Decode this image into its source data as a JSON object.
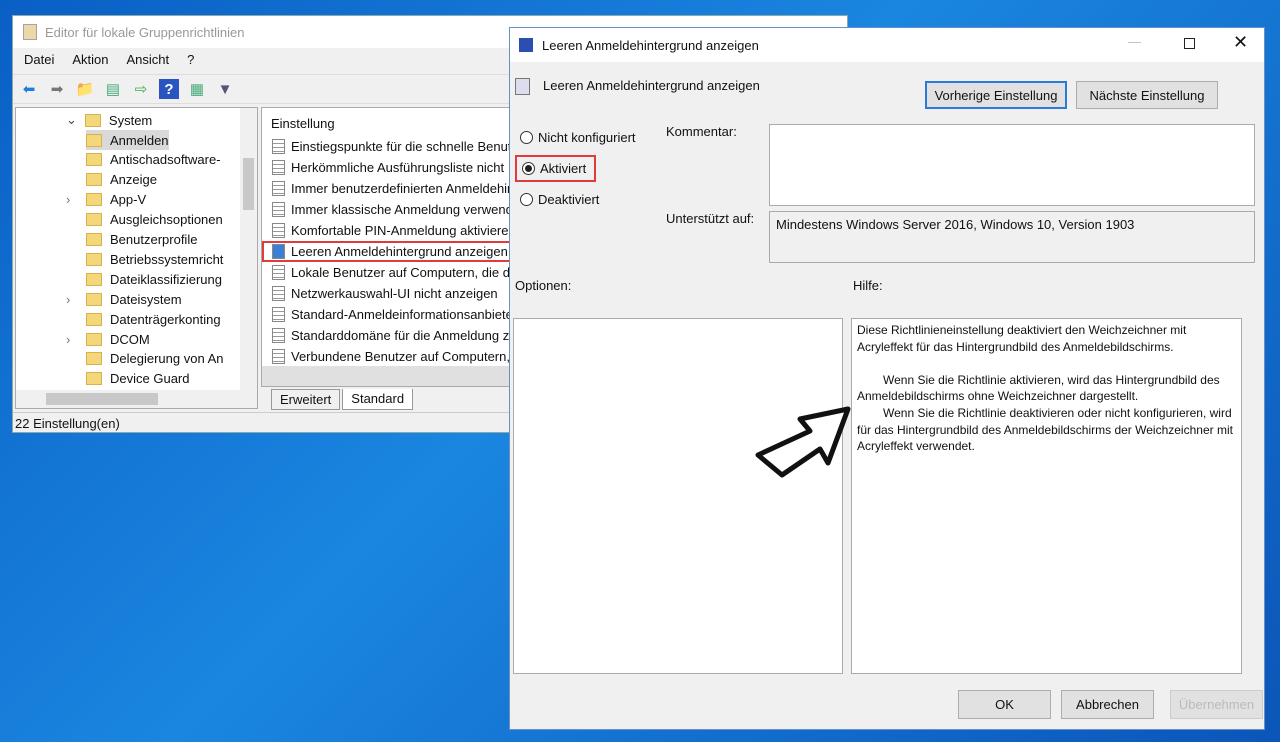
{
  "gpedit": {
    "title": "Editor für lokale Gruppenrichtlinien",
    "menu": [
      "Datei",
      "Aktion",
      "Ansicht",
      "?"
    ],
    "tree": [
      {
        "label": "System",
        "expanded": true
      },
      {
        "label": "Anmelden",
        "selected": true
      },
      {
        "label": "Antischadsoftware-"
      },
      {
        "label": "Anzeige"
      },
      {
        "label": "App-V",
        "expandable": true
      },
      {
        "label": "Ausgleichsoptionen"
      },
      {
        "label": "Benutzerprofile"
      },
      {
        "label": "Betriebssystemricht"
      },
      {
        "label": "Dateiklassifizierung"
      },
      {
        "label": "Dateisystem",
        "expandable": true
      },
      {
        "label": "Datenträgerkonting"
      },
      {
        "label": "DCOM",
        "expandable": true
      },
      {
        "label": "Delegierung von An"
      },
      {
        "label": "Device Guard"
      }
    ],
    "list_header": "Einstellung",
    "list": [
      "Einstiegspunkte für die schnelle Benutzerumschaltung",
      "Herkömmliche Ausführungsliste nicht",
      "Immer benutzerdefinierten Anmeldehintergrund",
      "Immer klassische Anmeldung verwenden",
      "Komfortable PIN-Anmeldung aktivieren",
      "Leeren Anmeldehintergrund anzeigen",
      "Lokale Benutzer auf Computern, die d",
      "Netzwerkauswahl-UI nicht anzeigen",
      "Standard-Anmeldeinformationsanbieter",
      "Standarddomäne für die Anmeldung z",
      "Verbundene Benutzer auf Computern,"
    ],
    "selected_index": 5,
    "tabs": [
      "Erweitert",
      "Standard"
    ],
    "active_tab": "Standard",
    "status": "22 Einstellung(en)"
  },
  "dialog": {
    "title": "Leeren Anmeldehintergrund anzeigen",
    "setting_name": "Leeren Anmeldehintergrund anzeigen",
    "prev_button": "Vorherige Einstellung",
    "next_button": "Nächste Einstellung",
    "radios": [
      "Nicht konfiguriert",
      "Aktiviert",
      "Deaktiviert"
    ],
    "selected_radio": "Aktiviert",
    "comment_label": "Kommentar:",
    "comment_value": "",
    "supported_label": "Unterstützt auf:",
    "supported_value": "Mindestens Windows Server 2016, Windows 10, Version 1903",
    "options_label": "Optionen:",
    "help_label": "Hilfe:",
    "help": [
      "Diese Richtlinieneinstellung deaktiviert den Weichzeichner mit Acryleffekt für das Hintergrundbild des Anmeldebildschirms.",
      "Wenn Sie die Richtlinie aktivieren, wird das Hintergrundbild des Anmeldebildschirms ohne Weichzeichner dargestellt.",
      "Wenn Sie die Richtlinie deaktivieren oder nicht konfigurieren, wird für das Hintergrundbild des Anmeldebildschirms der Weichzeichner mit Acryleffekt verwendet."
    ],
    "ok": "OK",
    "cancel": "Abbrechen",
    "apply": "Übernehmen"
  },
  "colors": {
    "highlight": "#e03c3c",
    "desktop": "#1a86e0"
  }
}
